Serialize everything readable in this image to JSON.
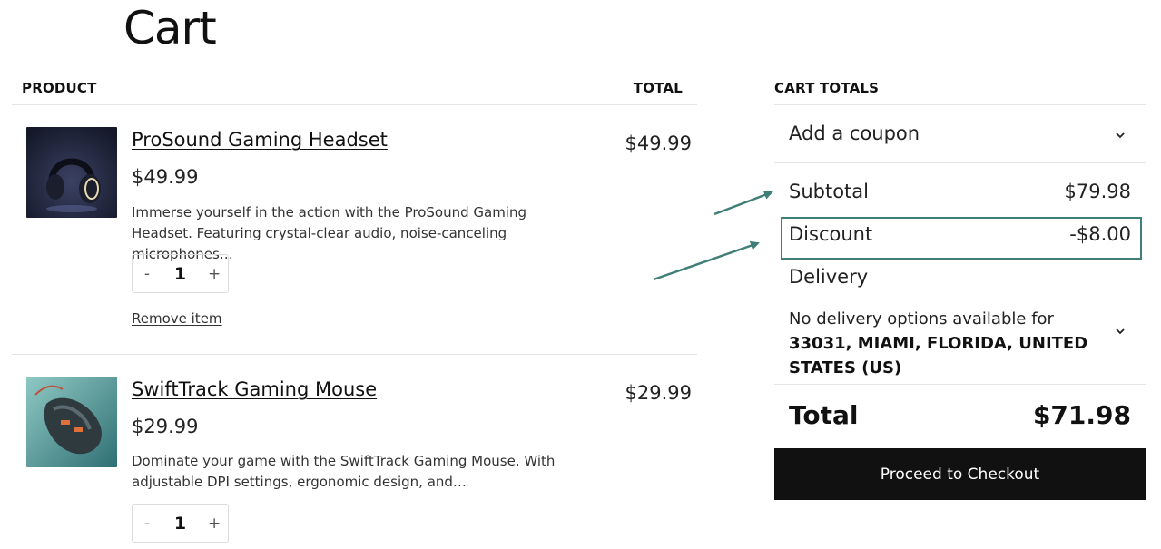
{
  "page": {
    "title": "Cart"
  },
  "table": {
    "product_header": "PRODUCT",
    "total_header": "TOTAL"
  },
  "items": [
    {
      "name": "ProSound Gaming Headset",
      "price": "$49.99",
      "description": "Immerse yourself in the action with the ProSound Gaming Headset. Featuring crystal-clear audio, noise-canceling microphones…",
      "quantity": "1",
      "line_total": "$49.99",
      "remove_label": "Remove item",
      "qty_minus": "-",
      "qty_plus": "+",
      "image_icon": "headset-image"
    },
    {
      "name": "SwiftTrack Gaming Mouse",
      "price": "$29.99",
      "description": "Dominate your game with the SwiftTrack Gaming Mouse. With adjustable DPI settings, ergonomic design, and…",
      "quantity": "1",
      "line_total": "$29.99",
      "qty_minus": "-",
      "qty_plus": "+",
      "image_icon": "mouse-image"
    }
  ],
  "totals": {
    "header": "CART TOTALS",
    "coupon_label": "Add a coupon",
    "subtotal_label": "Subtotal",
    "subtotal_value": "$79.98",
    "discount_label": "Discount",
    "discount_value": "-$8.00",
    "delivery_label": "Delivery",
    "delivery_note_prefix": "No delivery options available for ",
    "delivery_location": "33031, MIAMI, FLORIDA, UNITED STATES (US)",
    "total_label": "Total",
    "total_value": "$71.98",
    "checkout_label": "Proceed to Checkout"
  },
  "colors": {
    "annotation": "#3f7f78",
    "button_bg": "#111111",
    "divider": "#e4e4e4"
  }
}
